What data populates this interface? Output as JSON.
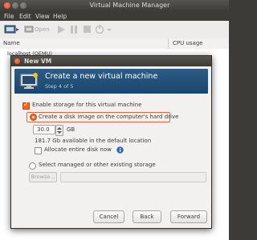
{
  "window": {
    "title": "Virtual Machine Manager",
    "menu": [
      "File",
      "Edit",
      "View",
      "Help"
    ],
    "toolbar": {
      "open_label": "Open"
    },
    "columns": {
      "name": "Name",
      "cpu": "CPU usage"
    },
    "connection": "localhost (QEMU)"
  },
  "dialog": {
    "title": "New VM",
    "banner_title": "Create a new virtual machine",
    "banner_step": "Step 4 of 5",
    "enable_storage_label": "Enable storage for this virtual machine",
    "enable_storage_checked": true,
    "create_disk_label": "Create a disk image on the computer's hard drive",
    "create_disk_selected": true,
    "disk_size": "30.0",
    "disk_unit": "GB",
    "available_text": "181.7 Gb available in the default location",
    "allocate_label": "Allocate entire disk now",
    "allocate_checked": false,
    "existing_label": "Select managed or other existing storage",
    "existing_selected": false,
    "browse_label": "Browse...",
    "path_value": "",
    "cancel_label": "Cancel",
    "back_label": "Back",
    "forward_label": "Forward"
  },
  "colors": {
    "accent": "#e8672f",
    "banner": "#1c456b",
    "titlebar": "#3c3b37",
    "info": "#3465a4"
  },
  "icons": [
    "close-icon",
    "minimize-icon",
    "maximize-icon",
    "new-vm-icon",
    "open-icon",
    "run-icon",
    "pause-icon",
    "stop-icon",
    "shutdown-icon",
    "chevron-down-icon",
    "monitor-icon",
    "info-icon",
    "spin-up-icon",
    "spin-down-icon"
  ]
}
